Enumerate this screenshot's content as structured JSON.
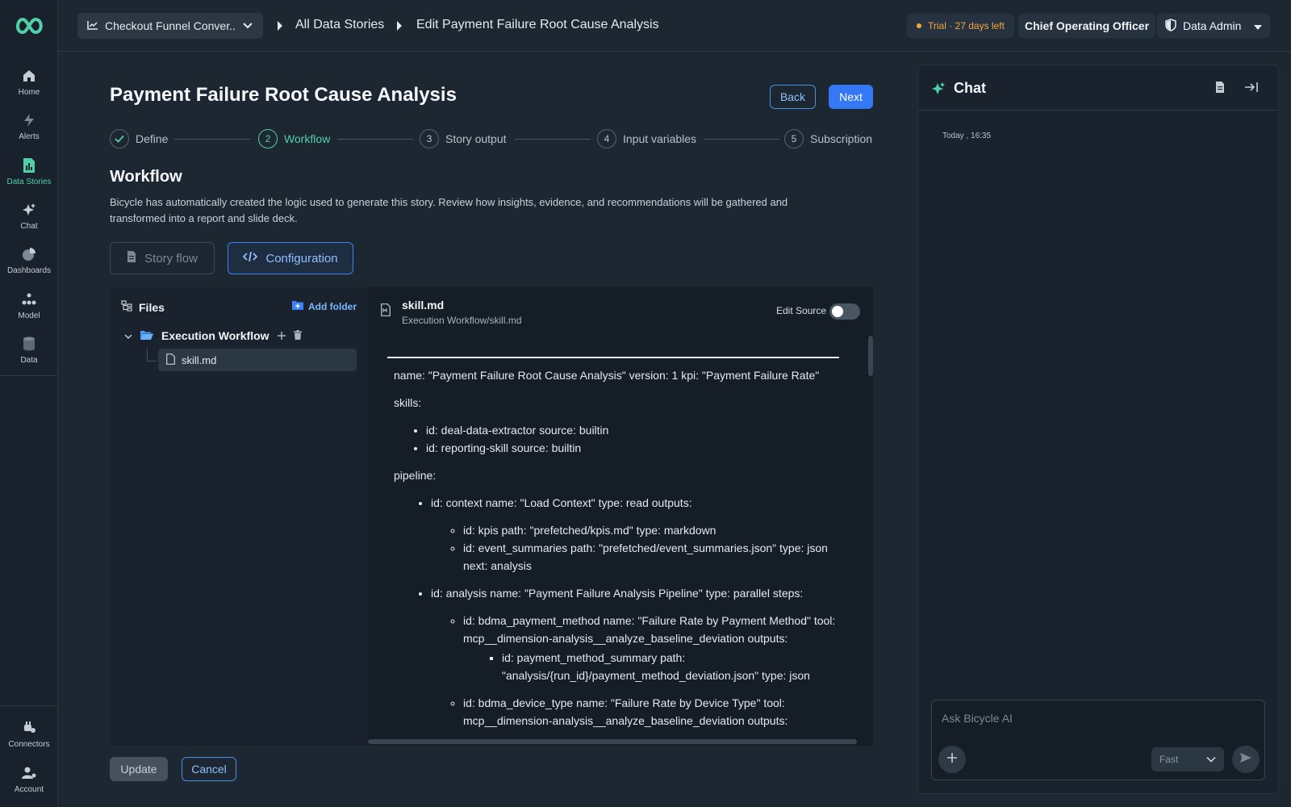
{
  "topbar": {
    "story_select": "Checkout Funnel Conver...",
    "breadcrumb_1": "All Data Stories",
    "breadcrumb_2": "Edit Payment Failure Root Cause Analysis",
    "trial": "Trial · 27 days left",
    "role": "Chief Operating Officer",
    "admin": "Data Admin"
  },
  "sidebar": {
    "items": [
      {
        "label": "Home",
        "icon": "home-icon"
      },
      {
        "label": "Alerts",
        "icon": "bolt-icon"
      },
      {
        "label": "Data Stories",
        "icon": "data-stories-icon",
        "active": true
      },
      {
        "label": "Chat",
        "icon": "sparkle-icon"
      },
      {
        "label": "Dashboards",
        "icon": "pie-icon"
      },
      {
        "label": "Model",
        "icon": "model-icon"
      },
      {
        "label": "Data",
        "icon": "database-icon"
      }
    ],
    "bottom": [
      {
        "label": "Connectors",
        "icon": "plug-icon"
      },
      {
        "label": "Account",
        "icon": "account-icon"
      }
    ]
  },
  "page": {
    "title": "Payment Failure Root Cause Analysis",
    "back": "Back",
    "next": "Next",
    "steps": [
      {
        "num": "✓",
        "label": "Define"
      },
      {
        "num": "2",
        "label": "Workflow"
      },
      {
        "num": "3",
        "label": "Story output"
      },
      {
        "num": "4",
        "label": "Input variables"
      },
      {
        "num": "5",
        "label": "Subscription"
      }
    ],
    "section_title": "Workflow",
    "section_desc": "Bicycle has automatically created the logic used to generate this story. Review how insights, evidence, and recommendations will be gathered and transformed into a report and slide deck.",
    "tab_story_flow": "Story flow",
    "tab_configuration": "Configuration",
    "update": "Update",
    "cancel": "Cancel"
  },
  "files": {
    "title": "Files",
    "add_folder": "Add folder",
    "folder": "Execution Workflow",
    "file": "skill.md"
  },
  "editor": {
    "file_name": "skill.md",
    "file_path": "Execution Workflow/skill.md",
    "edit_source": "Edit Source",
    "edit_source_on": false,
    "line_header": "name: \"Payment Failure Root Cause Analysis\" version: 1 kpi: \"Payment Failure Rate\"",
    "skills_label": "skills:",
    "skills": [
      "id: deal-data-extractor source: builtin",
      "id: reporting-skill source: builtin"
    ],
    "pipeline_label": "pipeline:",
    "p1": "id: context name: \"Load Context\" type: read outputs:",
    "p1_a": "id: kpis path: \"prefetched/kpis.md\" type: markdown",
    "p1_b": "id: event_summaries path: \"prefetched/event_summaries.json\" type: json next: analysis",
    "p2": "id: analysis name: \"Payment Failure Analysis Pipeline\" type: parallel steps:",
    "p2_a": "id: bdma_payment_method name: \"Failure Rate by Payment Method\" tool: mcp__dimension-analysis__analyze_baseline_deviation outputs:",
    "p2_a_1": "id: payment_method_summary path: \"analysis/{run_id}/payment_method_deviation.json\" type: json",
    "p2_b": "id: bdma_device_type name: \"Failure Rate by Device Type\" tool: mcp__dimension-analysis__analyze_baseline_deviation outputs:"
  },
  "chat": {
    "title": "Chat",
    "timestamp": "Today , 16:35",
    "placeholder": "Ask Bicycle AI",
    "mode": "Fast"
  },
  "colors": {
    "accent_green": "#4fd1a5",
    "accent_blue": "#3478f6",
    "trial_orange": "#f0a93c"
  }
}
